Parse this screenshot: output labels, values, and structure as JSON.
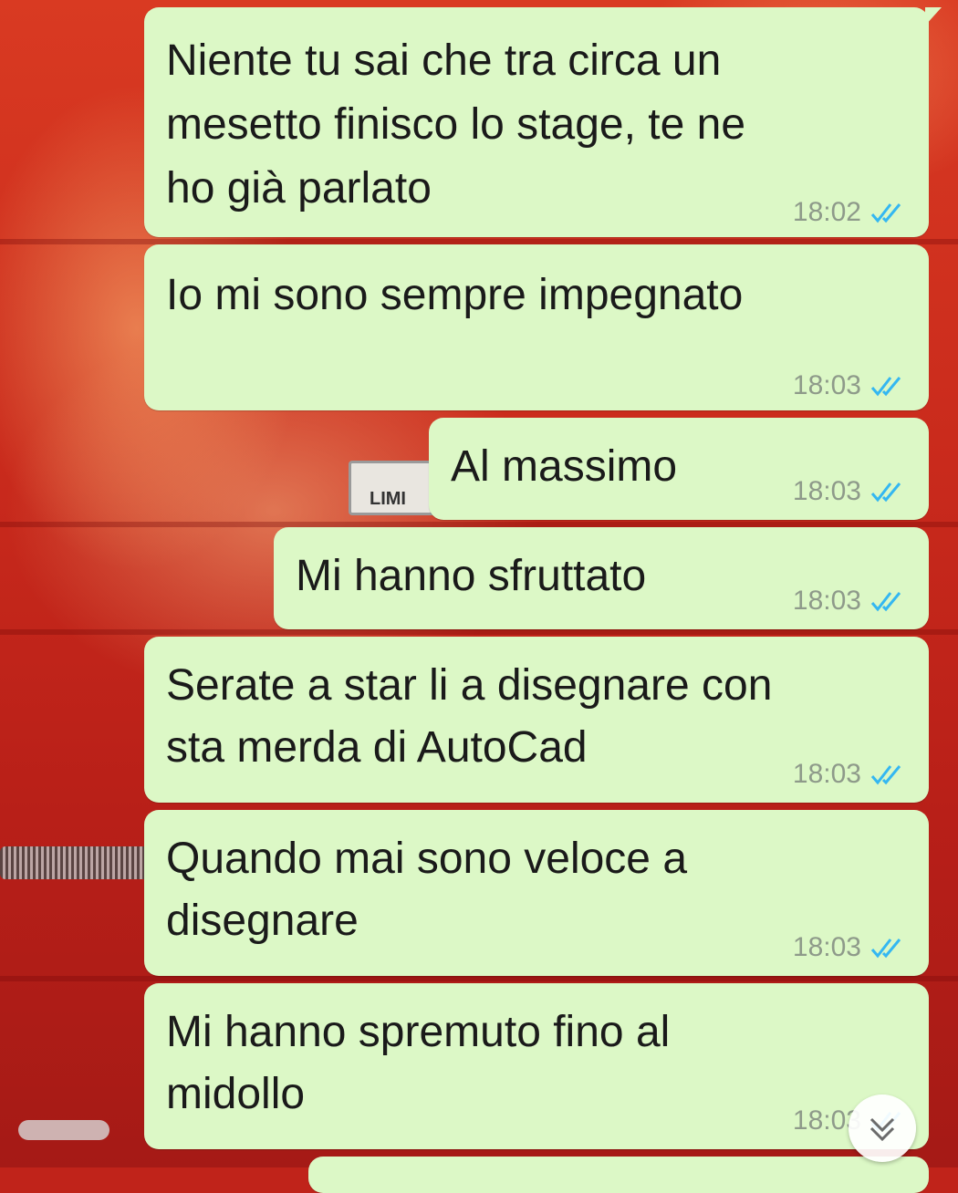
{
  "messages": [
    {
      "text": "Niente tu sai che tra circa un\nmesetto finisco lo stage, te ne\nho già parlato",
      "time": "18:02",
      "status": "read"
    },
    {
      "text": "Io mi sono sempre impegnato",
      "time": "18:03",
      "status": "read"
    },
    {
      "text": "Al massimo",
      "time": "18:03",
      "status": "read"
    },
    {
      "text": "Mi hanno sfruttato",
      "time": "18:03",
      "status": "read"
    },
    {
      "text": "Serate a star li a disegnare con\nsta merda di AutoCad",
      "time": "18:03",
      "status": "read"
    },
    {
      "text": "Quando mai sono veloce a\ndisegnare",
      "time": "18:03",
      "status": "read"
    },
    {
      "text": "Mi hanno spremuto fino al\nmidollo",
      "time": "18:03",
      "status": "read"
    }
  ],
  "background": {
    "label": "LIMI",
    "icon": "wallpaper-image"
  },
  "scroll_button": {
    "icon": "double-chevron-down-icon"
  },
  "colors": {
    "outgoing_bubble": "#dcf8c6",
    "read_ticks": "#34b7f1",
    "time_text": "#8e9a8a"
  }
}
